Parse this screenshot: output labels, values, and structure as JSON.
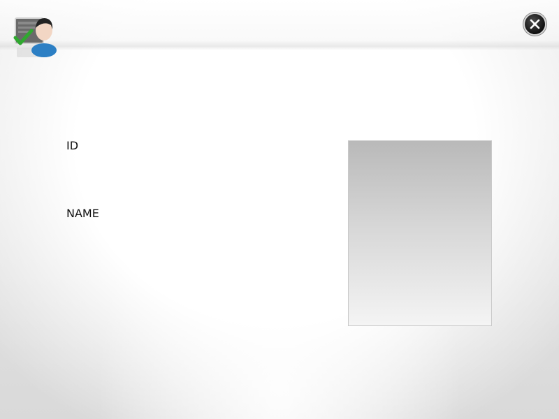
{
  "header": {
    "app_icon": "user-id-check-icon",
    "close_icon": "close-icon"
  },
  "form": {
    "id_label": "ID",
    "name_label": "NAME"
  },
  "photo": {
    "icon": "photo-placeholder"
  },
  "colors": {
    "background": "#e3e3e3",
    "photo_top": "#b9b9b9",
    "photo_bottom": "#f4f4f4",
    "check_green": "#2fa82f",
    "shirt_blue": "#2c7fc4"
  }
}
